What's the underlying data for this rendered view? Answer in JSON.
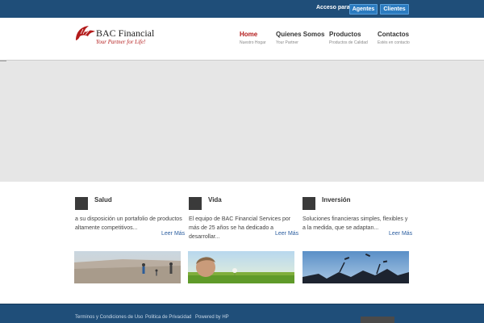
{
  "topbar": {
    "access_label": "Acceso para:",
    "agentes_label": "Agentes",
    "clientes_label": "Clientes"
  },
  "logo": {
    "name": "BAC Financial",
    "tagline": "Your Partner for Life!",
    "brand_color": "#b31b1b"
  },
  "nav": [
    {
      "label": "Home",
      "sub": "Nuestro Hogar",
      "active": true
    },
    {
      "label": "Quienes Somos",
      "sub": "Your Partner",
      "active": false
    },
    {
      "label": "Productos",
      "sub": "Productos de Calidad",
      "active": false
    },
    {
      "label": "Contactos",
      "sub": "Estés en contacto",
      "active": false
    }
  ],
  "features": [
    {
      "title": "Salud",
      "desc": "a su disposición un portafolio de productos altamente competitivos...",
      "more": "Leer Más"
    },
    {
      "title": "Vida",
      "desc": "El equipo de BAC Financial Services por más de 25 años se ha dedicado a desarrollar...",
      "more": "Leer Más"
    },
    {
      "title": "Inversión",
      "desc": "Soluciones financieras simples, flexibles y a la medida, que se adaptan...",
      "more": "Leer Más"
    }
  ],
  "footer": {
    "links": [
      "Terminos y Condiciones de Uso",
      "Politica de Privacidad",
      "Powered by HP"
    ]
  },
  "colors": {
    "topbar": "#1f4e79",
    "button": "#2b7bc0",
    "nav_active": "#b31b1b",
    "link": "#2a5d9f"
  }
}
